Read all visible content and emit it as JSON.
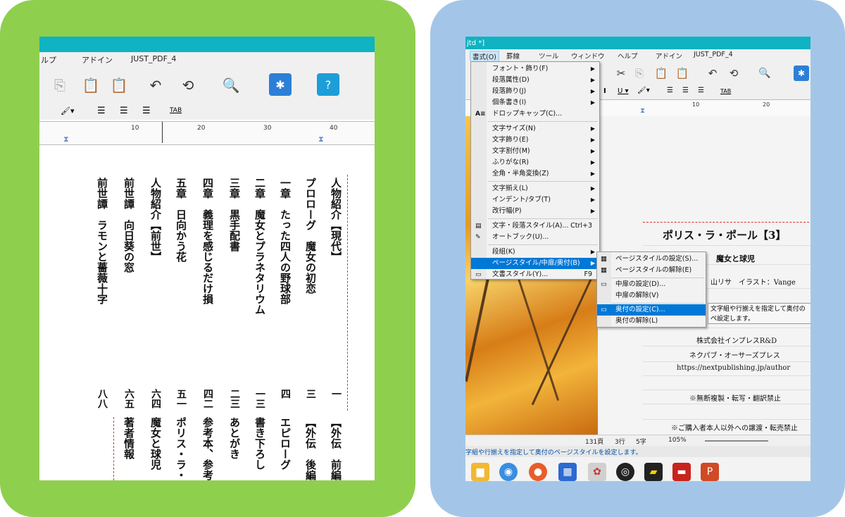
{
  "left": {
    "menubar": [
      "ルプ",
      "アドイン",
      "JUST_PDF_4"
    ],
    "ruler_ticks": [
      "10",
      "20",
      "30",
      "40"
    ],
    "tab_label": "TAB",
    "columns": [
      {
        "title": "人物紹介【現代】",
        "page": "一"
      },
      {
        "title": "プロローグ　魔女の初恋",
        "page": "三"
      },
      {
        "title": "一章　たった四人の野球部",
        "page": "四"
      },
      {
        "title": "二章　魔女とプラネタリウム",
        "page": "一三"
      },
      {
        "title": "三章　黒手配書",
        "page": "二三"
      },
      {
        "title": "四章　義理を感じるだけ損",
        "page": "四二"
      },
      {
        "title": "五章　日向かう花",
        "page": "五一"
      },
      {
        "title": "人物紹介【前世】",
        "page": "六四"
      },
      {
        "title": "前世譚　向日葵の窓",
        "page": "六五"
      },
      {
        "title": "前世譚　ラモンと薔薇十字",
        "page": "八八"
      }
    ],
    "columns2": [
      "【外伝　前編",
      "【外伝　後編",
      "エピローグ",
      "書き下ろし",
      "あとがき",
      "参考本、参考",
      "ポリス・ラ・",
      "魔女と球児",
      "著者情報"
    ]
  },
  "right": {
    "title_fragment": "jtd *]",
    "menubar": [
      "書式(O)",
      "罫線",
      "ツール",
      "ウィンドウ",
      "ヘルプ",
      "アドイン",
      "JUST_PDF_4"
    ],
    "ruler_ticks": [
      "10",
      "20"
    ],
    "tab_label": "TAB",
    "menu": [
      {
        "label": "フォント・飾り(F)",
        "arrow": true
      },
      {
        "label": "段落属性(D)",
        "arrow": true
      },
      {
        "label": "段落飾り(J)",
        "arrow": true
      },
      {
        "label": "個条書き(I)",
        "arrow": true
      },
      {
        "label": "ドロップキャップ(C)...",
        "arrow": false
      },
      {
        "label": "文字サイズ(N)",
        "arrow": true
      },
      {
        "label": "文字飾り(E)",
        "arrow": true
      },
      {
        "label": "文字割付(M)",
        "arrow": true
      },
      {
        "label": "ふりがな(R)",
        "arrow": true
      },
      {
        "label": "全角・半角変換(Z)",
        "arrow": true
      },
      {
        "label": "文字揃え(L)",
        "arrow": true
      },
      {
        "label": "インデント/タブ(T)",
        "arrow": true
      },
      {
        "label": "改行幅(P)",
        "arrow": true
      },
      {
        "label": "文字・段落スタイル(A)...",
        "shortcut": "Ctrl+3"
      },
      {
        "label": "オートブック(U)...",
        "arrow": false
      },
      {
        "label": "段組(K)",
        "arrow": true
      },
      {
        "label": "ページスタイル/中扉/奥付(B)",
        "arrow": true
      },
      {
        "label": "文書スタイル(Y)...",
        "shortcut": "F9"
      }
    ],
    "submenu": [
      "ページスタイルの設定(S)...",
      "ページスタイルの解除(E)",
      "中扉の設定(D)...",
      "中扉の解除(V)",
      "奥付の設定(C)...",
      "奥付の解除(L)"
    ],
    "tooltip": "文字組や行揃えを指定して奥付のペ設定します。",
    "doc": {
      "title": "ポリス・ラ・ポール【3】",
      "subtitle": "魔女と球児",
      "author": "山リサ　イラスト：Vange",
      "publisher": "株式会社インプレスR&D",
      "imprint": "ネクパブ・オーサーズプレス",
      "url": "https://nextpublishing.jp/author",
      "notice1": "※無断複製・転写・翻訳禁止",
      "notice2": "※ご購入者本人以外への譲渡・転売禁止"
    },
    "status": {
      "page": "131頁",
      "line": "3行",
      "char": "5字",
      "zoom": "105%"
    },
    "statusbar_text": "字組や行揃えを指定して奥付のページスタイルを設定します。",
    "taskbar": [
      "folder-icon",
      "chrome-icon",
      "firefox-icon",
      "app-icon",
      "paint-icon",
      "media-icon",
      "sticky-icon",
      "pdf-icon",
      "powerpoint-icon"
    ],
    "colors": {
      "accent": "#0fb3c1",
      "highlight": "#0078d7"
    }
  }
}
